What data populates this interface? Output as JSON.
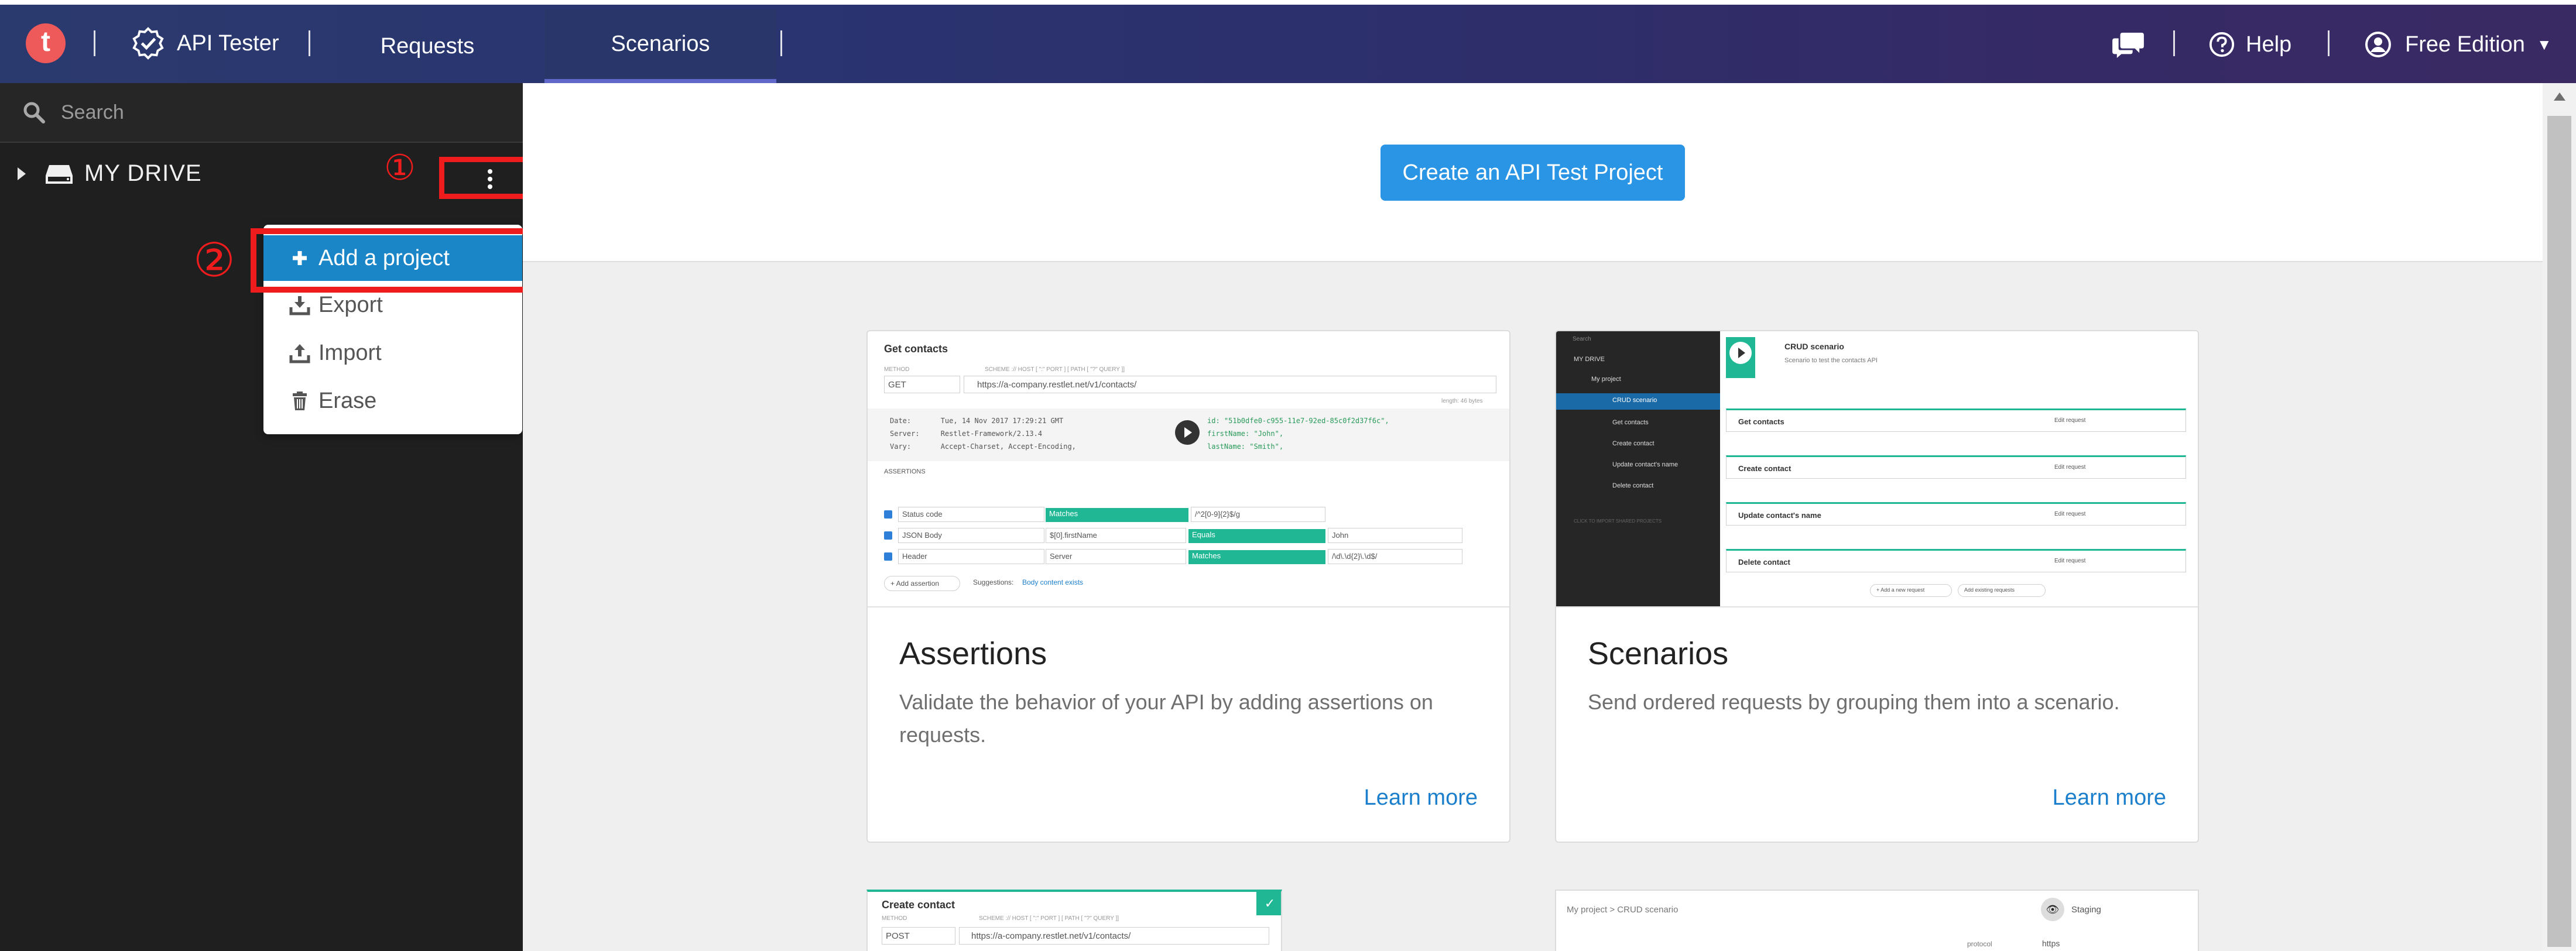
{
  "app": {
    "logo_letter": "t",
    "name": "API Tester"
  },
  "nav": {
    "tabs": [
      {
        "label": "Requests",
        "active": false
      },
      {
        "label": "Scenarios",
        "active": true
      }
    ],
    "help_label": "Help",
    "edition_label": "Free Edition"
  },
  "sidebar": {
    "search_placeholder": "Search",
    "drive_label": "MY DRIVE"
  },
  "context_menu": {
    "items": [
      {
        "label": "Add a project",
        "icon": "plus-icon",
        "highlighted": true
      },
      {
        "label": "Export",
        "icon": "download-icon"
      },
      {
        "label": "Import",
        "icon": "upload-icon"
      },
      {
        "label": "Erase",
        "icon": "trash-icon"
      }
    ]
  },
  "annotations": {
    "step1": "①",
    "step2": "②"
  },
  "main": {
    "create_button": "Create an API Test Project",
    "cards": [
      {
        "title": "Assertions",
        "description": "Validate the behavior of your API by adding assertions on requests.",
        "link": "Learn more",
        "preview": {
          "header": "Get contacts",
          "hint": "SCHEME :// HOST [ \":\" PORT ] [ PATH [ \"?\" QUERY ]]",
          "method_label": "METHOD",
          "method": "GET",
          "url": "https://a-company.restlet.net/v1/contacts/",
          "length": "length: 46 bytes",
          "headers": [
            {
              "k": "Date:",
              "v": "Tue, 14 Nov 2017 17:29:21 GMT"
            },
            {
              "k": "Server:",
              "v": "Restlet-Framework/2.13.4"
            },
            {
              "k": "Vary:",
              "v": "Accept-Charset, Accept-Encoding,"
            }
          ],
          "json_lines": [
            "id: \"51b0dfe0-c955-11e7-92ed-85c0f2d37f6c\",",
            "firstName: \"John\",",
            "lastName: \"Smith\","
          ],
          "assertions_label": "ASSERTIONS",
          "assertions": [
            {
              "subject": "Status code",
              "op": "Matches",
              "value": "/^2[0-9]{2}$/g"
            },
            {
              "subject": "JSON Body",
              "path": "$[0].firstName",
              "op": "Equals",
              "value": "John"
            },
            {
              "subject": "Header",
              "path": "Server",
              "op": "Matches",
              "value": "/\\d\\.\\d{2}\\.\\d$/"
            }
          ],
          "add_assertion": "+ Add assertion",
          "suggestions_label": "Suggestions:",
          "suggestion": "Body content exists"
        }
      },
      {
        "title": "Scenarios",
        "description": "Send ordered requests by grouping them into a scenario.",
        "link": "Learn more",
        "preview": {
          "search": "Search",
          "drive": "MY DRIVE",
          "project": "My project",
          "scenario": "CRUD scenario",
          "tree_items": [
            "Get contacts",
            "Create contact",
            "Update contact's name",
            "Delete contact"
          ],
          "footer_hint": "CLICK TO IMPORT SHARED PROJECTS",
          "title": "CRUD scenario",
          "subtitle": "Scenario to test the contacts API",
          "steps": [
            "Get contacts",
            "Create contact",
            "Update contact's name",
            "Delete contact"
          ],
          "edit_label": "Edit request",
          "add_new": "+ Add a new request",
          "add_existing": "Add existing requests"
        }
      }
    ],
    "bottom_cards": [
      {
        "header": "Create contact",
        "method": "POST",
        "url": "https://a-company.restlet.net/v1/contacts/",
        "hint": "SCHEME :// HOST [ \":\" PORT ] [ PATH [ \"?\" QUERY ]]",
        "method_label": "METHOD"
      },
      {
        "breadcrumb": "My project  >  CRUD scenario",
        "env": "Staging",
        "protocol_label": "protocol",
        "protocol_value": "https"
      }
    ]
  },
  "colors": {
    "accent": "#2a94e5",
    "highlight": "#ee1c1c",
    "success": "#20b894",
    "sidebar": "#1f1f1f"
  }
}
